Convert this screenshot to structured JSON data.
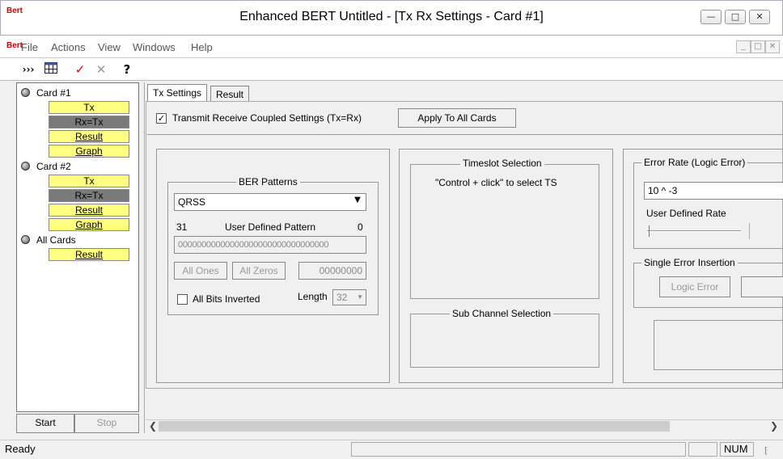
{
  "window": {
    "title": "Enhanced BERT Untitled - [Tx Rx Settings - Card #1]",
    "logo": "Bert"
  },
  "menu": {
    "logo": "Bert",
    "items": [
      "File",
      "Actions",
      "View",
      "Windows",
      "Help"
    ]
  },
  "toolbar": {
    "icons": [
      "double-chevron-icon",
      "table-icon",
      "checkmark-icon",
      "close-icon",
      "help-icon"
    ]
  },
  "tree": {
    "cards": [
      {
        "label": "Card #1",
        "nodes": [
          "Tx",
          "Rx=Tx",
          "Result",
          "Graph"
        ]
      },
      {
        "label": "Card #2",
        "nodes": [
          "Tx",
          "Rx=Tx",
          "Result",
          "Graph"
        ]
      },
      {
        "label": "All Cards",
        "nodes": [
          "Result"
        ]
      }
    ],
    "start_label": "Start",
    "stop_label": "Stop"
  },
  "tabs": [
    "Tx Settings",
    "Result"
  ],
  "tx": {
    "coupled_label": "Transmit Receive Coupled Settings (Tx=Rx)",
    "apply_label": "Apply To All Cards",
    "ber_title": "BER Patterns",
    "pattern_value": "QRSS",
    "udp_left": "31",
    "udp_label": "User Defined Pattern",
    "udp_right": "0",
    "udp_bits": "00000000000000000000000000000000",
    "all_ones": "All Ones",
    "all_zeros": "All Zeros",
    "hex_value": "00000000",
    "inverted_label": "All Bits Inverted",
    "length_label": "Length",
    "length_value": "32",
    "timeslot_title": "Timeslot Selection",
    "timeslot_hint": "\"Control + click\" to select TS",
    "subchannel_title": "Sub Channel Selection",
    "error_rate_title": "Error Rate (Logic Error)",
    "error_rate_value": "10 ^ -3",
    "user_rate_label": "User Defined Rate",
    "single_error_title": "Single Error Insertion",
    "logic_error_label": "Logic Error"
  },
  "status": {
    "text": "Ready",
    "num": "NUM"
  }
}
